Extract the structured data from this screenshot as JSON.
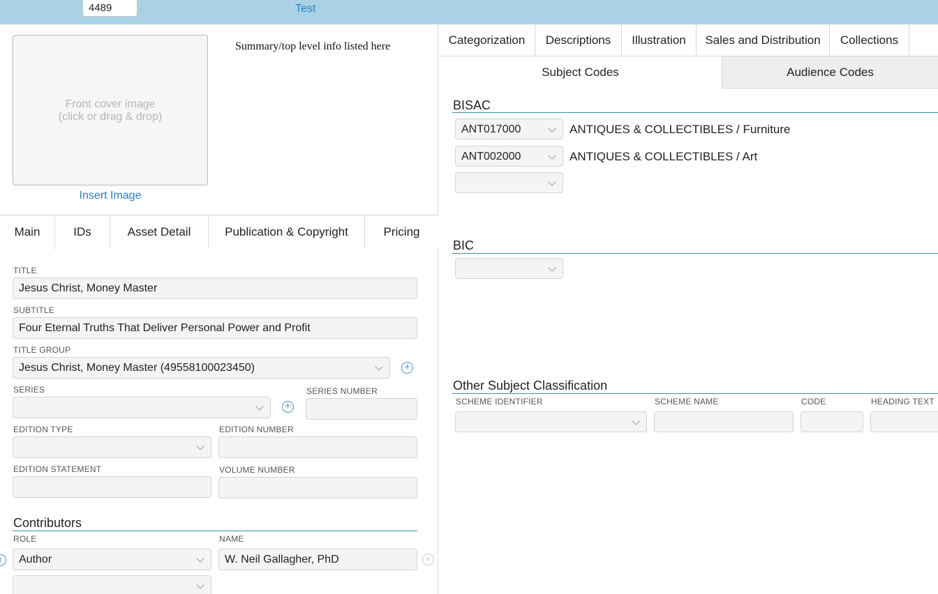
{
  "topbar": {
    "record_id": "4489",
    "test_link": "Test"
  },
  "cover": {
    "placeholder_line1": "Front cover image",
    "placeholder_line2": "(click or drag & drop)",
    "insert_label": "Insert Image"
  },
  "summary": "Summary/top level info listed here",
  "left_tabs": [
    "Main",
    "IDs",
    "Asset Detail",
    "Publication & Copyright",
    "Pricing"
  ],
  "main_form": {
    "title_label": "TITLE",
    "title_value": "Jesus Christ, Money Master",
    "subtitle_label": "SUBTITLE",
    "subtitle_value": "Four Eternal Truths That Deliver Personal Power and Profit",
    "title_group_label": "TITLE GROUP",
    "title_group_value": "Jesus Christ, Money Master (49558100023450)",
    "series_label": "SERIES",
    "series_value": "",
    "series_number_label": "SERIES NUMBER",
    "series_number_value": "",
    "edition_type_label": "EDITION TYPE",
    "edition_type_value": "",
    "edition_number_label": "EDITION NUMBER",
    "edition_number_value": "",
    "edition_statement_label": "EDITION STATEMENT",
    "edition_statement_value": "",
    "volume_number_label": "VOLUME NUMBER",
    "volume_number_value": ""
  },
  "contributors": {
    "heading": "Contributors",
    "role_label": "ROLE",
    "name_label": "NAME",
    "rows": [
      {
        "role": "Author",
        "name": "W. Neil Gallagher, PhD"
      },
      {
        "role": "",
        "name": ""
      }
    ]
  },
  "right_tabs": [
    "Categorization",
    "Descriptions",
    "Illustration",
    "Sales and Distribution",
    "Collections"
  ],
  "sub_tabs": [
    "Subject Codes",
    "Audience Codes"
  ],
  "bisac": {
    "heading": "BISAC",
    "rows": [
      {
        "code": "ANT017000",
        "text": "ANTIQUES & COLLECTIBLES / Furniture"
      },
      {
        "code": "ANT002000",
        "text": "ANTIQUES & COLLECTIBLES / Art"
      },
      {
        "code": "",
        "text": ""
      }
    ]
  },
  "bic": {
    "heading": "BIC",
    "code": ""
  },
  "other_subject": {
    "heading": "Other Subject Classification",
    "scheme_identifier_label": "SCHEME IDENTIFIER",
    "scheme_name_label": "SCHEME NAME",
    "code_label": "CODE",
    "heading_text_label": "HEADING TEXT"
  },
  "colors": {
    "topbar": "#a9d2e7",
    "link": "#2a7fc0",
    "accent_line": "#3b8ea8"
  },
  "icons": [
    "add-circle-icon",
    "chevron-down-icon",
    "info-icon",
    "remove-circle-icon"
  ]
}
